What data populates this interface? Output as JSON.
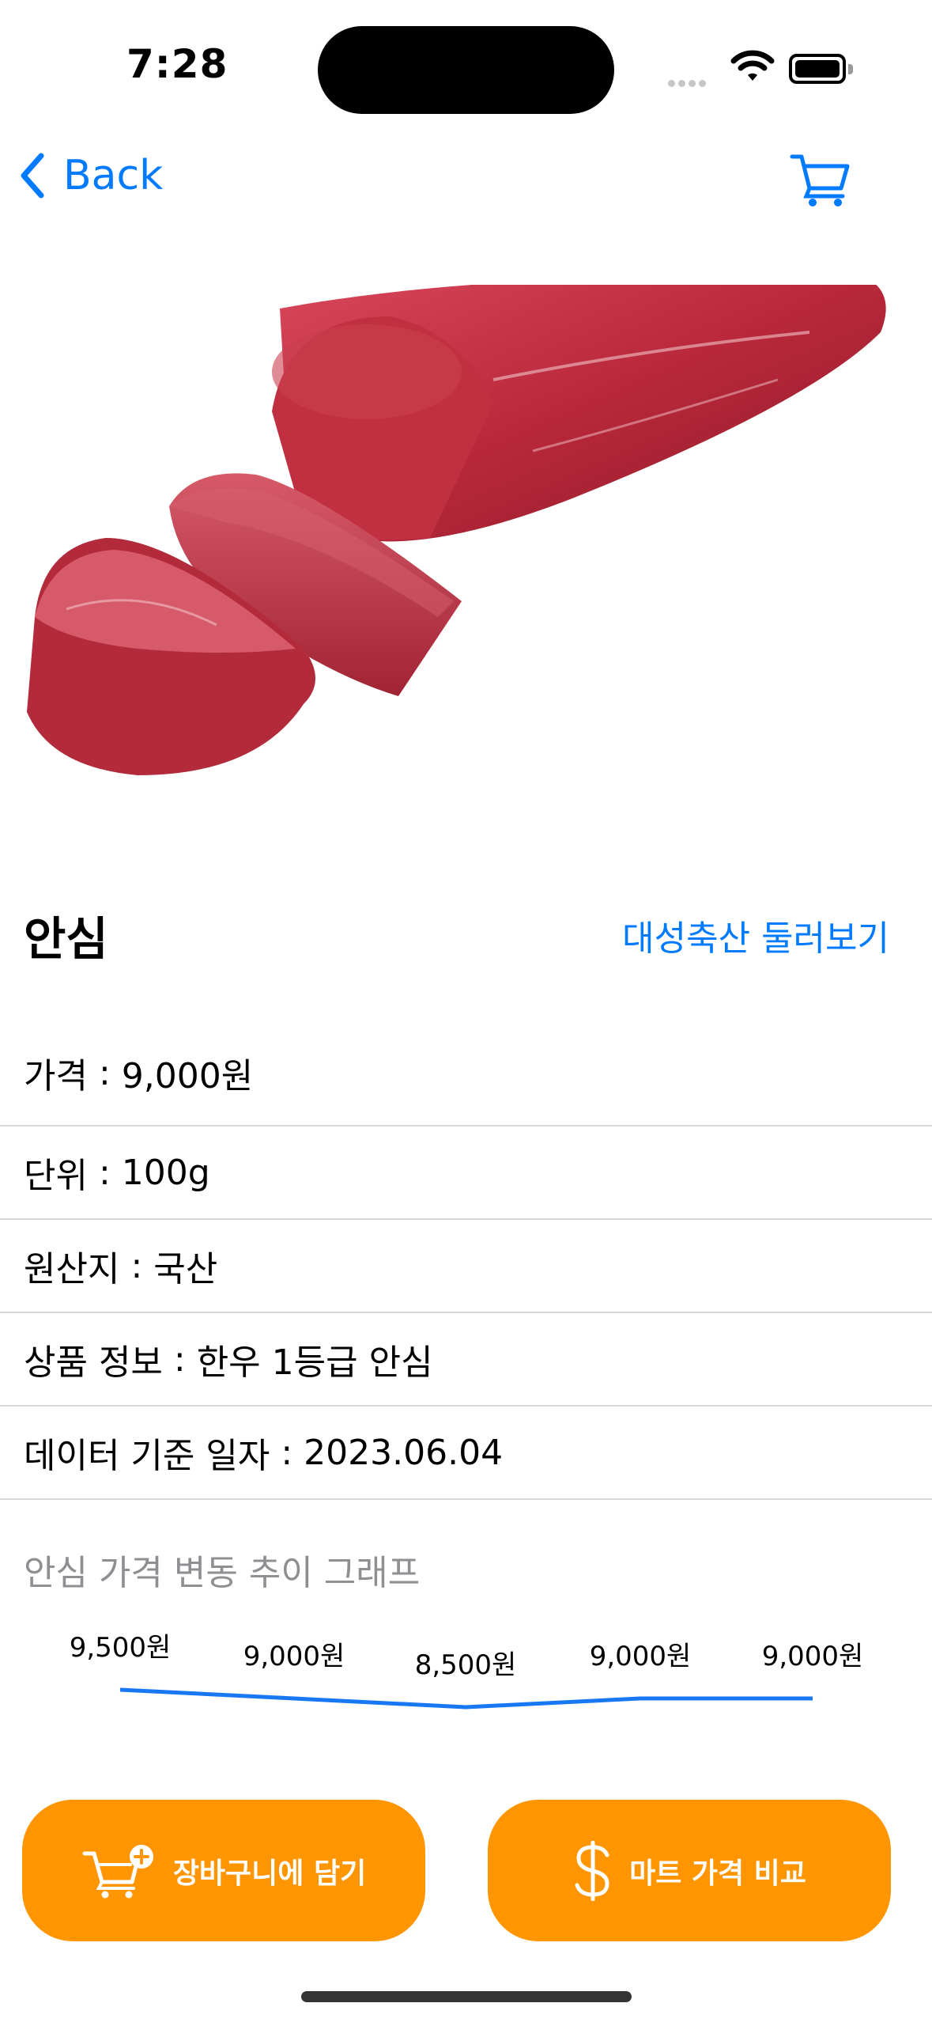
{
  "status_bar": {
    "time": "7:28"
  },
  "nav": {
    "back_label": "Back"
  },
  "product": {
    "name": "안심",
    "browse_link": "대성축산 둘러보기"
  },
  "info_rows": [
    {
      "label": "가격",
      "value": "9,000원"
    },
    {
      "label": "단위",
      "value": "100g"
    },
    {
      "label": "원산지",
      "value": "국산"
    },
    {
      "label": "상품 정보",
      "value": "한우 1등급 안심"
    },
    {
      "label": "데이터 기준 일자",
      "value": "2023.06.04"
    }
  ],
  "separator": " : ",
  "graph": {
    "title": "안심 가격 변동 추이 그래프"
  },
  "chart_data": {
    "type": "line",
    "values": [
      9500,
      9000,
      8500,
      9000,
      9000
    ],
    "value_labels": [
      "9,500원",
      "9,000원",
      "8,500원",
      "9,000원",
      "9,000원"
    ],
    "color": "#1877f2"
  },
  "actions": {
    "add_cart_label": "장바구니에 담기",
    "compare_label": "마트 가격 비교"
  },
  "colors": {
    "accent": "#007aff",
    "button": "#ff9500"
  }
}
